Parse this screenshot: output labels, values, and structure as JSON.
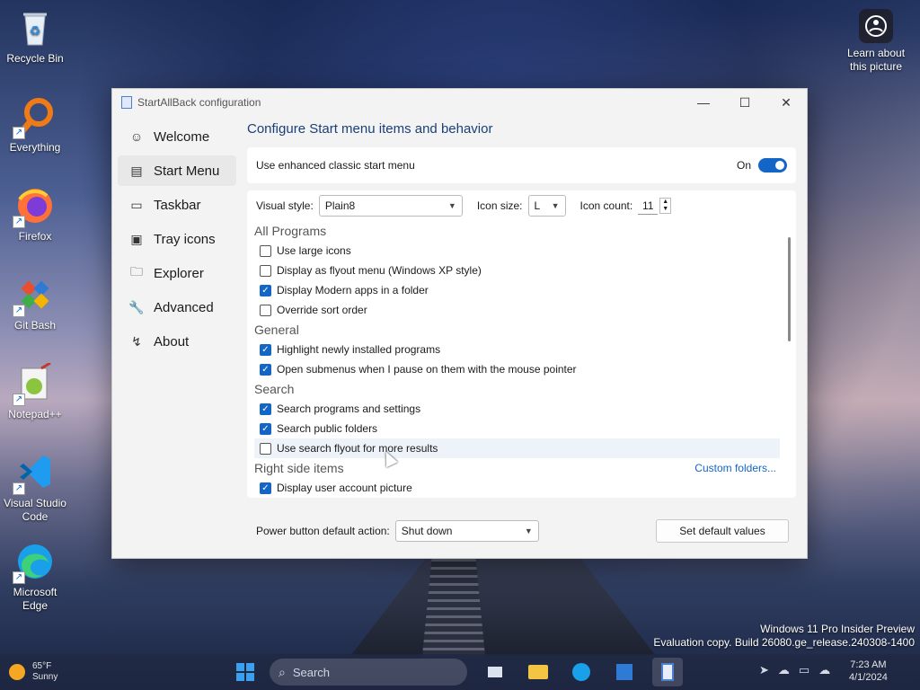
{
  "desktop": {
    "icons": [
      {
        "label": "Recycle Bin",
        "icon": "recycle-bin-icon"
      },
      {
        "label": "Everything",
        "icon": "everything-search-icon"
      },
      {
        "label": "Firefox",
        "icon": "firefox-icon"
      },
      {
        "label": "Git Bash",
        "icon": "git-bash-icon"
      },
      {
        "label": "Notepad++",
        "icon": "notepad-plus-plus-icon"
      },
      {
        "label": "Visual Studio Code",
        "icon": "vscode-icon"
      },
      {
        "label": "Microsoft Edge",
        "icon": "edge-icon"
      }
    ],
    "learn_label": "Learn about this picture",
    "watermark_line1": "Windows 11 Pro Insider Preview",
    "watermark_line2": "Evaluation copy. Build 26080.ge_release.240308-1400"
  },
  "window": {
    "title": "StartAllBack configuration",
    "controls": {
      "minimize": "—",
      "maximize": "☐",
      "close": "✕"
    }
  },
  "nav": {
    "items": [
      {
        "label": "Welcome",
        "icon": "smile-icon"
      },
      {
        "label": "Start Menu",
        "icon": "start-menu-icon"
      },
      {
        "label": "Taskbar",
        "icon": "taskbar-icon"
      },
      {
        "label": "Tray icons",
        "icon": "tray-icon"
      },
      {
        "label": "Explorer",
        "icon": "folder-icon"
      },
      {
        "label": "Advanced",
        "icon": "wrench-icon"
      },
      {
        "label": "About",
        "icon": "about-icon"
      }
    ],
    "active_index": 1
  },
  "main": {
    "title": "Configure Start menu items and behavior",
    "enhanced_label": "Use enhanced classic start menu",
    "enhanced_state": "On",
    "visual_style_label": "Visual style:",
    "visual_style_value": "Plain8",
    "icon_size_label": "Icon size:",
    "icon_size_value": "L",
    "icon_count_label": "Icon count:",
    "icon_count_value": "11",
    "groups": {
      "all_programs": {
        "title": "All Programs",
        "items": [
          {
            "label": "Use large icons",
            "checked": false
          },
          {
            "label": "Display as flyout menu (Windows XP style)",
            "checked": false
          },
          {
            "label": "Display Modern apps in a folder",
            "checked": true
          },
          {
            "label": "Override sort order",
            "checked": false
          }
        ]
      },
      "general": {
        "title": "General",
        "items": [
          {
            "label": "Highlight newly installed programs",
            "checked": true
          },
          {
            "label": "Open submenus when I pause on them with the mouse pointer",
            "checked": true
          }
        ]
      },
      "search": {
        "title": "Search",
        "items": [
          {
            "label": "Search programs and settings",
            "checked": true
          },
          {
            "label": "Search public folders",
            "checked": true
          },
          {
            "label": "Use search flyout for more results",
            "checked": false
          }
        ]
      },
      "right_side": {
        "title": "Right side items",
        "link": "Custom folders...",
        "items": [
          {
            "label": "Display user account picture",
            "checked": true
          }
        ]
      }
    },
    "power_label": "Power button default action:",
    "power_value": "Shut down",
    "defaults_button": "Set default values"
  },
  "taskbar": {
    "weather_temp": "65°F",
    "weather_desc": "Sunny",
    "search_placeholder": "Search",
    "clock_time": "7:23 AM",
    "clock_date": "4/1/2024"
  },
  "colors": {
    "accent": "#1466c6",
    "title": "#1a3f78"
  }
}
